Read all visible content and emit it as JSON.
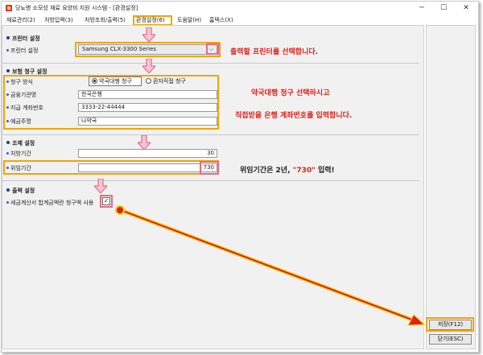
{
  "window": {
    "title": "당뇨병 소모성 재료 요양비 지원 시스템 - [환경설정]",
    "controls": {
      "minimize": "─",
      "maximize": "☐",
      "close": "✕"
    }
  },
  "menu": [
    "재료관리(2)",
    "처방입력(3)",
    "처방조회/출력(5)",
    "환경설정(6)",
    "도움말(H)",
    "홈텍스(X)"
  ],
  "printer_section": {
    "title": "프린터 설정",
    "label": "프린터 설정",
    "selected_printer": "Samsung CLX-3300 Series",
    "annotation": "출력할 프린터를 선택합니다."
  },
  "insurance_section": {
    "title": "보험 청구 설정",
    "claim_method_label": "청구 방식",
    "options": [
      "약국대행 청구",
      "환자직접 청구"
    ],
    "selected_option": "약국대행 청구",
    "bank_label": "금융기관명",
    "bank_value": "한국은행",
    "account_label": "지급 계좌번호",
    "account_value": "3333-22-44444",
    "holder_label": "예금주명",
    "holder_value": "나약국",
    "annotation_1": "약국대행 청구 선택하시고",
    "annotation_2": "직접받을 은행 계좌번호를 입력합니다."
  },
  "lookup_section": {
    "title": "조제 설정",
    "prescription_period_label": "처방기간",
    "prescription_period_value": "30",
    "delegation_period_label": "위임기간",
    "delegation_period_value": "730",
    "annotation_prefix": "위임기간은 2년, ",
    "annotation_highlight": "\"730\"",
    "annotation_suffix": " 입력!"
  },
  "output_section": {
    "title": "출력 설정",
    "checkbox_label": "세금계산서 합계금액란 청구액 사용",
    "checkbox_checked": true,
    "check_mark": "✓"
  },
  "buttons": {
    "save": "저장(F12)",
    "close": "닫기(ESC)"
  },
  "colors": {
    "orange_highlight": "#f2a400",
    "pink_arrow": "#e56a8c",
    "red_annotation": "#e0201b"
  }
}
